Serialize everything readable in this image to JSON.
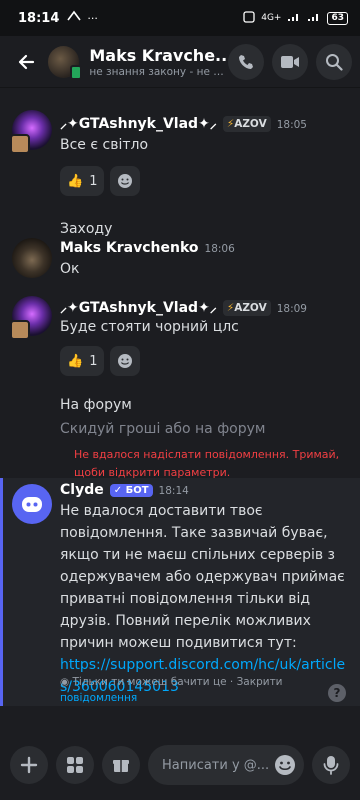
{
  "status_bar": {
    "time": "18:14",
    "battery": "63",
    "network": "4G+"
  },
  "header": {
    "title": "Maks Kravche...",
    "subtitle": "не знання закону - не звіл..."
  },
  "messages": [
    {
      "id": "m1",
      "author": "⸝✦GTAshnyk_Vlad✦⸝",
      "tag": "AZOV",
      "time": "18:05",
      "lines": [
        "Все є світло"
      ],
      "reaction_count": "1",
      "followup": "Заходу"
    },
    {
      "id": "m2",
      "author": "Maks Kravchenko",
      "time": "18:06",
      "lines": [
        "Ок"
      ]
    },
    {
      "id": "m3",
      "author": "⸝✦GTAshnyk_Vlad✦⸝",
      "tag": "AZOV",
      "time": "18:09",
      "lines": [
        "Буде стояти чорний цлс"
      ],
      "reaction_count": "1",
      "followup": "На форум",
      "pending": "Скидуй гроші або на форум",
      "error": "Не вдалося надіслати повідомлення. Тримай, щоби відкрити параметри."
    }
  ],
  "clyde": {
    "author": "Clyde",
    "badge": "БОТ",
    "time": "18:14",
    "text": "Не вдалося доставити твоє повідомлення. Таке зазвичай буває, якщо ти не маєш спільних серверів з одержувачем або одержувач приймає приватні повідомлення тільки від друзів. Повний перелік можливих причин можеш подивитися тут:",
    "link": "https://support.discord.com/hc/uk/articles/360060145013",
    "note": "Тільки ти можеш бачити це · Закрити",
    "note_link": "повідомлення"
  },
  "composer": {
    "placeholder": "Написати у @..."
  }
}
